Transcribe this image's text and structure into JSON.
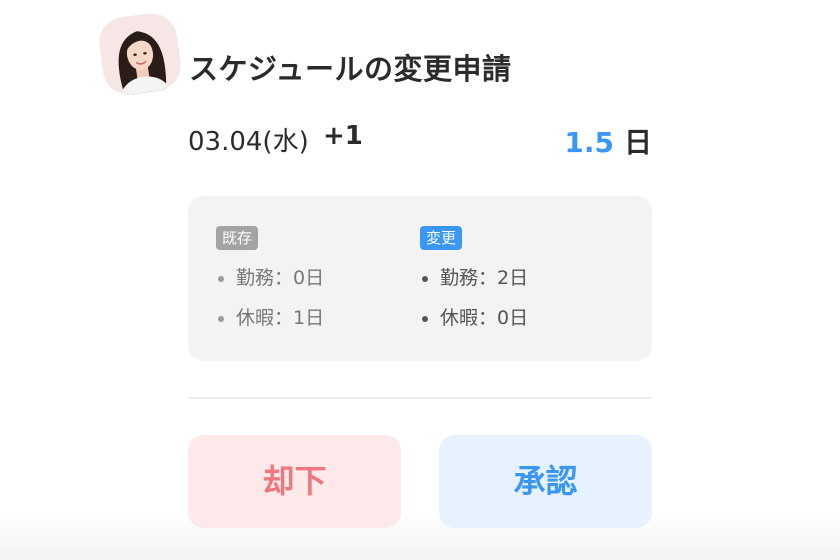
{
  "header": {
    "title": "スケジュールの変更申請",
    "avatar_alt": "applicant avatar"
  },
  "request": {
    "date": "03.04(水)",
    "extra_days": "+1",
    "amount_value": "1.5",
    "amount_unit": "日"
  },
  "comparison": {
    "existing": {
      "badge": "既存",
      "items": [
        "勤務：0日",
        "休暇：1日"
      ]
    },
    "changed": {
      "badge": "変更",
      "items": [
        "勤務：2日",
        "休暇：0日"
      ]
    }
  },
  "actions": {
    "reject_label": "却下",
    "approve_label": "承認"
  },
  "colors": {
    "accent_blue": "#3a97f5",
    "reject_red": "#f0777f",
    "reject_bg": "#fde9ea",
    "approve_bg": "#e6f2fd",
    "card_bg": "#f3f3f3"
  }
}
